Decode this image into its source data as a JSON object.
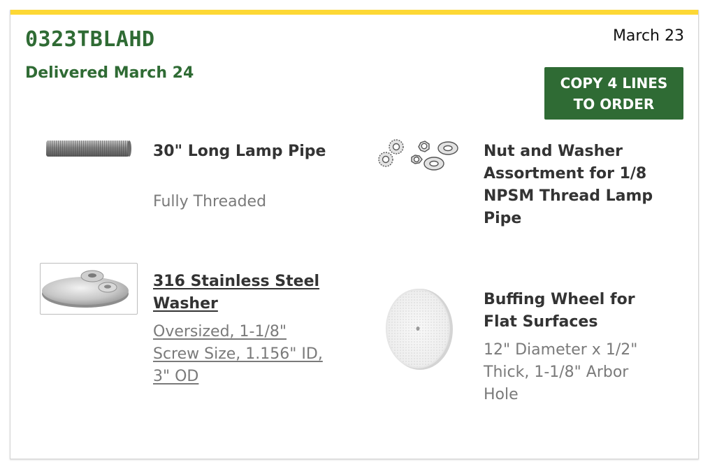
{
  "colors": {
    "accent_yellow": "#fdd835",
    "brand_green": "#2f6b34",
    "text_dark": "#333333",
    "text_gray": "#7a7a7a"
  },
  "order": {
    "id": "0323TBLAHD",
    "date": "March 23",
    "delivery_status": "Delivered March 24",
    "copy_button_label": "COPY 4 LINES TO ORDER"
  },
  "items": [
    {
      "title": "30\" Long Lamp Pipe",
      "description": "Fully Threaded",
      "icon": "threaded-pipe-icon",
      "is_link": false
    },
    {
      "title": "Nut and Washer Assortment for 1/8 NPSM Thread Lamp Pipe",
      "description": "",
      "icon": "nut-washer-assortment-icon",
      "is_link": false
    },
    {
      "title": "316 Stainless Steel Washer",
      "description": "Oversized, 1-1/8\" Screw Size, 1.156\" ID, 3\" OD",
      "icon": "washer-icon",
      "is_link": true
    },
    {
      "title": "Buffing Wheel for Flat Surfaces",
      "description": "12\" Diameter x 1/2\" Thick, 1-1/8\" Arbor Hole",
      "icon": "buffing-wheel-icon",
      "is_link": false
    }
  ]
}
